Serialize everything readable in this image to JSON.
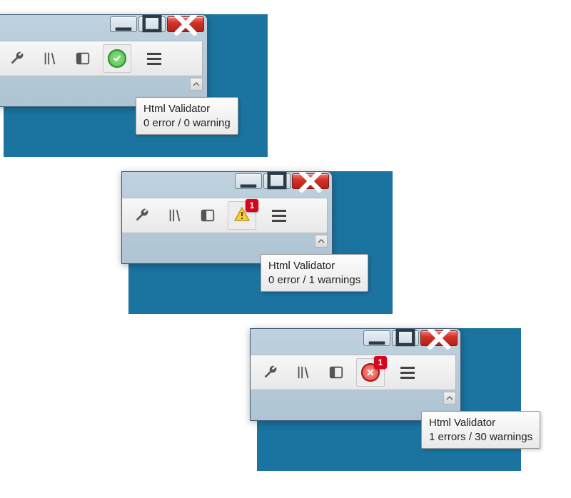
{
  "states": [
    {
      "tooltip_title": "Html Validator",
      "tooltip_status": "0 error / 0 warning",
      "icon_type": "ok",
      "badge": null
    },
    {
      "tooltip_title": "Html Validator",
      "tooltip_status": "0 error / 1 warnings",
      "icon_type": "warn",
      "badge": "1"
    },
    {
      "tooltip_title": "Html Validator",
      "tooltip_status": "1 errors / 30 warnings",
      "icon_type": "error",
      "badge": "1"
    }
  ]
}
